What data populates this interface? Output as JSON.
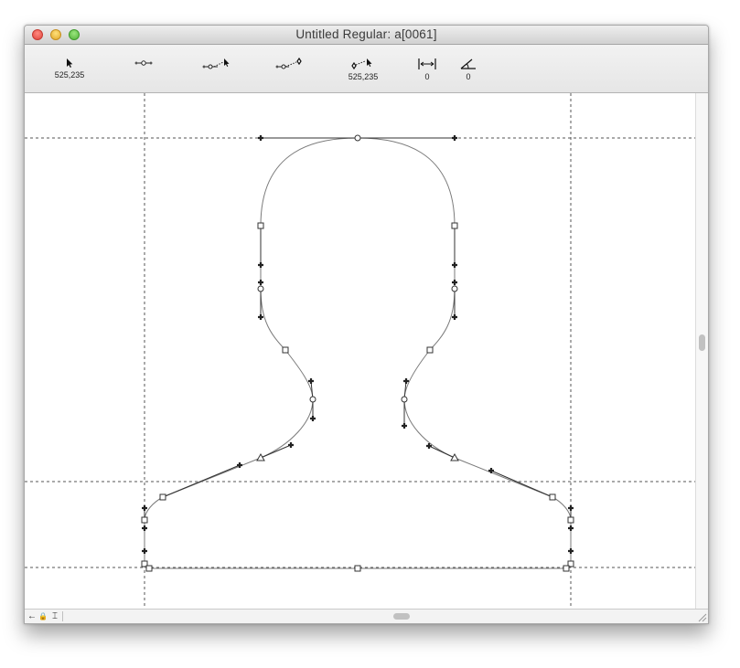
{
  "window": {
    "title": "Untitled Regular: a[0061]"
  },
  "toolbar": {
    "pointer_value": "525,235",
    "add_point_value": "",
    "select_handle_value": "",
    "add_corner_value": "",
    "connect_value": "525,235",
    "measure_value": "0",
    "angle_value": "0"
  },
  "icons": {
    "pointer": "arrow-cursor-icon",
    "add_point": "add-point-icon",
    "select_handle": "handle-cursor-icon",
    "add_corner": "corner-point-icon",
    "connect": "connect-cursor-icon",
    "measure": "measure-width-icon",
    "angle": "angle-icon",
    "back": "left-arrow-icon",
    "lock": "lock-icon",
    "text_cursor": "text-cursor-icon"
  },
  "glyph": {
    "name": "a[0061]",
    "outline_color": "#7a7a7a",
    "guide_color": "#555555"
  },
  "bottom": {
    "back_glyph": "←",
    "lock_glyph": "🔒",
    "cursor_glyph": "⌶"
  }
}
